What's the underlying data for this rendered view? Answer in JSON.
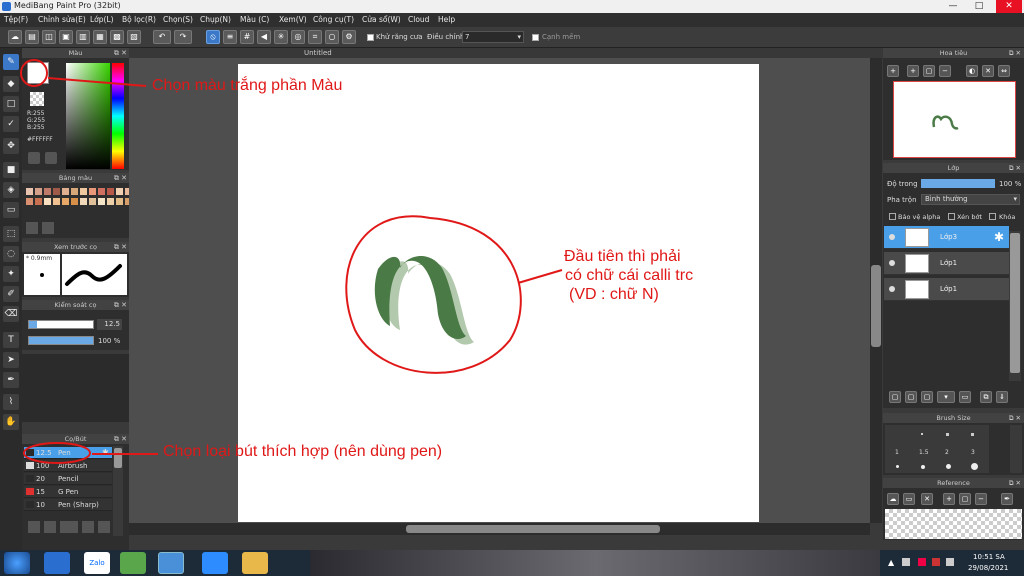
{
  "window": {
    "title": "MediBang Paint Pro (32bit)",
    "min": "—",
    "max": "□",
    "close": "✕"
  },
  "menu": [
    "Tệp(F)",
    "Chỉnh sửa(E)",
    "Lớp(L)",
    "Bộ lọc(R)",
    "Chọn(S)",
    "Chụp(N)",
    "Màu (C)",
    "Xem(V)",
    "Công cụ(T)",
    "Cửa sổ(W)",
    "Cloud",
    "Help"
  ],
  "toolbar": {
    "antialias_label": "Khử răng cưa",
    "adjust_label": "Điều chỉnh",
    "adjust_value": "7",
    "smooth_label": "Cạnh mềm"
  },
  "color_panel": {
    "title": "Màu",
    "r": "R:255",
    "g": "G:255",
    "b": "B:255",
    "hex": "#FFFFFF"
  },
  "palette_panel": {
    "title": "Bảng màu"
  },
  "brush_preview_panel": {
    "title": "Xem trước cọ",
    "size": "* 0.9mm"
  },
  "brush_control_panel": {
    "title": "Kiểm soát cọ",
    "size_value": "12.5",
    "opacity_value": "100 %",
    "size_fill": 0.13,
    "opacity_fill": 1.0
  },
  "brush_panel": {
    "title": "Cọ/Bút",
    "items": [
      {
        "size": "12.5",
        "name": "Pen",
        "color": "#2a2a2a"
      },
      {
        "size": "100",
        "name": "Airbrush",
        "color": "#dddddd"
      },
      {
        "size": "20",
        "name": "Pencil",
        "color": "#2a2a2a"
      },
      {
        "size": "15",
        "name": "G Pen",
        "color": "#e03030"
      },
      {
        "size": "10",
        "name": "Pen (Sharp)",
        "color": "#2a2a2a"
      }
    ]
  },
  "canvas": {
    "tab": "Untitled"
  },
  "navigator": {
    "title": "Hoa tiêu"
  },
  "layer_panel": {
    "title": "Lớp",
    "opacity_label": "Độ trong",
    "opacity_value": "100 %",
    "blend_label": "Pha trộn",
    "blend_value": "Bình thường",
    "protect_alpha": "Bảo vệ alpha",
    "clipping": "Xén bớt",
    "lock": "Khóa",
    "layers": [
      {
        "name": "Lớp3"
      },
      {
        "name": "Lớp1"
      },
      {
        "name": "Lớp1"
      }
    ]
  },
  "brush_size_panel": {
    "title": "Brush Size",
    "sizes": [
      "1",
      "1.5",
      "2",
      "3"
    ]
  },
  "reference_panel": {
    "title": "Reference"
  },
  "annotations": {
    "color": "Chọn màu trắng phần Màu",
    "brush": "Chọn loại bút thích hợp (nên dùng pen)",
    "letter_line1": "Đầu tiên thì phải",
    "letter_line2": "có chữ cái calli trc",
    "letter_line3": "(VD : chữ N)"
  },
  "taskbar": {
    "time": "10:51 SA",
    "date": "29/08/2021",
    "zalo": "Zalo"
  },
  "colors": {
    "stroke_green": "#4a7a45",
    "annotation_red": "#e01818",
    "accent_blue": "#4aa0e8"
  }
}
